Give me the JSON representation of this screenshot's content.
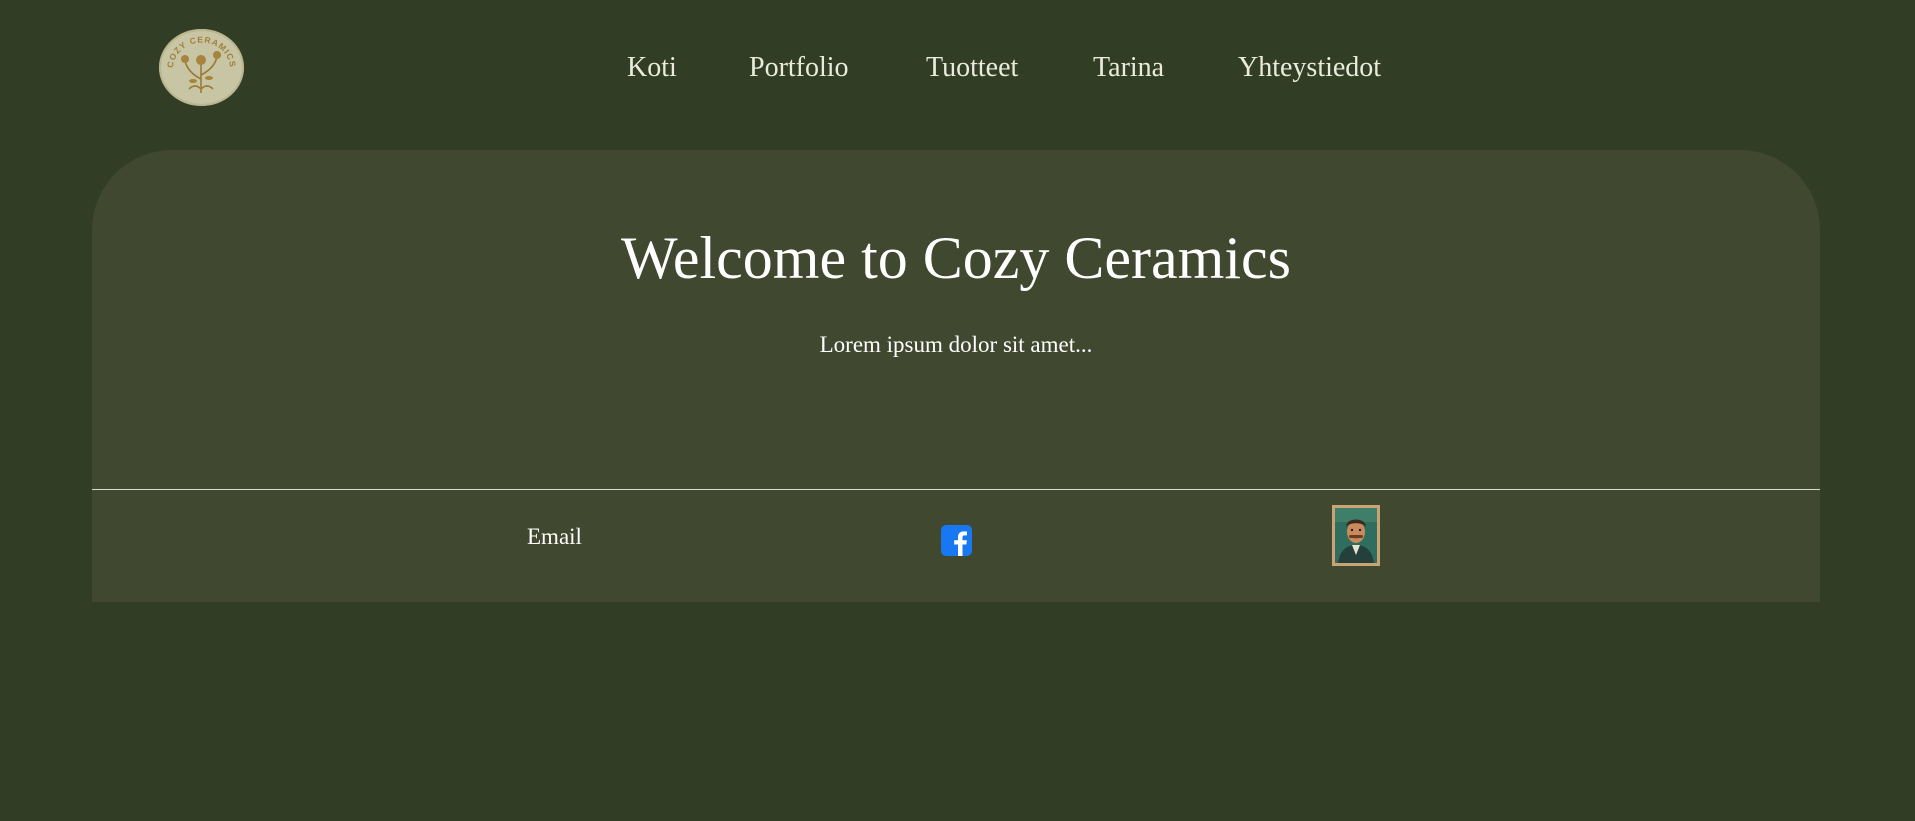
{
  "logo": {
    "text": "COZY CERAMICS",
    "icon": "flower-emblem-icon"
  },
  "nav": {
    "items": [
      {
        "label": "Koti"
      },
      {
        "label": "Portfolio"
      },
      {
        "label": "Tuotteet"
      },
      {
        "label": "Tarina"
      },
      {
        "label": "Yhteystiedot"
      }
    ]
  },
  "hero": {
    "title": "Welcome to Cozy Ceramics",
    "text": "Lorem ipsum dolor sit amet..."
  },
  "footer": {
    "email_label": "Email",
    "facebook_icon": "facebook-icon",
    "portrait_icon": "portrait-painting-icon"
  },
  "colors": {
    "background": "#313d24",
    "panel": "#40482f",
    "text": "#ffffff",
    "facebook": "#1877f2",
    "logo": "#c7c5a3"
  }
}
